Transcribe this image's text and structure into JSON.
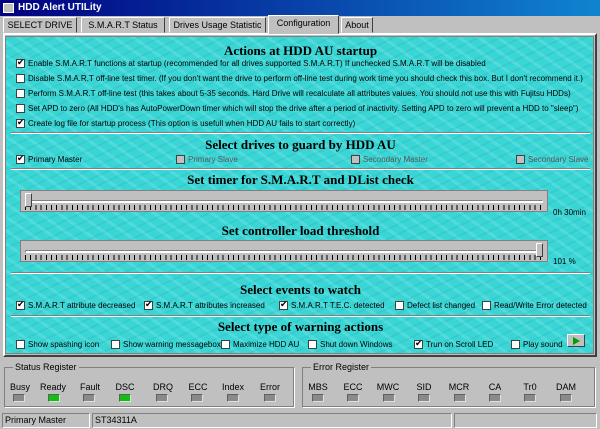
{
  "window": {
    "title": "HDD Alert UTILity"
  },
  "tabs": [
    {
      "label": "SELECT DRIVE"
    },
    {
      "label": "S.M.A.R.T Status"
    },
    {
      "label": "Drives Usage Statistic"
    },
    {
      "label": "Configuration"
    },
    {
      "label": "About"
    }
  ],
  "startup": {
    "heading": "Actions at HDD AU startup",
    "options": [
      {
        "label": "Enable S.M.A.R.T functions at startup (recommended for all drives supported S.M.A.R.T) If unchecked S.M.A.R.T will be disabled",
        "checked": true
      },
      {
        "label": "Disable S.M.A.R.T off-line test timer. (If you don't want the drive to perform off-line test during work time you should check this box. But I don't recommend it.)",
        "checked": false
      },
      {
        "label": "Perform S.M.A.R.T off-line test (this takes about 5-35 seconds. Hard Drive will recalculate all attributes values. You should not use this with Fujitsu HDDs)",
        "checked": false
      },
      {
        "label": "Set APD to zero (All HDD's has AutoPowerDown timer which will stop the drive after a period of inactivity. Setting APD to zero will prevent a HDD to \"sleep\")",
        "checked": false
      },
      {
        "label": "Create log file for startup process (This option is usefull when HDD AU fails to start correctly)",
        "checked": true
      }
    ]
  },
  "drives": {
    "heading": "Select drives to guard by HDD AU",
    "items": [
      {
        "label": "Primary Master",
        "checked": true,
        "enabled": true
      },
      {
        "label": "Primary Slave",
        "checked": false,
        "enabled": false
      },
      {
        "label": "Secondary Master",
        "checked": false,
        "enabled": false
      },
      {
        "label": "Secondary Slave",
        "checked": false,
        "enabled": false
      }
    ]
  },
  "timer": {
    "heading": "Set timer for S.M.A.R.T and DList check",
    "value_label": "0h 30min",
    "level": 0.0
  },
  "load": {
    "heading": "Set controller load threshold",
    "value_label": "101 %",
    "level": 1.0
  },
  "events": {
    "heading": "Select events to watch",
    "items": [
      {
        "label": "S.M.A.R.T attribute decreased",
        "checked": true
      },
      {
        "label": "S.M.A.R.T attributes increased",
        "checked": true
      },
      {
        "label": "S.M.A.R.T T.E.C. detected",
        "checked": true
      },
      {
        "label": "Defect list changed",
        "checked": false
      },
      {
        "label": "Read/Write Error detected",
        "checked": false
      }
    ]
  },
  "warnings": {
    "heading": "Select type of warning actions",
    "items": [
      {
        "label": "Show spashing icon",
        "checked": false
      },
      {
        "label": "Show warning messagebox",
        "checked": false
      },
      {
        "label": "Maximize HDD AU",
        "checked": false
      },
      {
        "label": "Shut down Windows",
        "checked": false
      },
      {
        "label": "Trun on Scroll LED",
        "checked": true
      },
      {
        "label": "Play sound",
        "checked": false
      }
    ]
  },
  "status_register": {
    "title": "Status Register",
    "bits": [
      {
        "label": "Busy",
        "on": false
      },
      {
        "label": "Ready",
        "on": true
      },
      {
        "label": "Fault",
        "on": false
      },
      {
        "label": "DSC",
        "on": true
      },
      {
        "label": "DRQ",
        "on": false
      },
      {
        "label": "ECC",
        "on": false
      },
      {
        "label": "Index",
        "on": false
      },
      {
        "label": "Error",
        "on": false
      }
    ]
  },
  "error_register": {
    "title": "Error Register",
    "bits": [
      {
        "label": "MBS",
        "on": false
      },
      {
        "label": "ECC",
        "on": false
      },
      {
        "label": "MWC",
        "on": false
      },
      {
        "label": "SID",
        "on": false
      },
      {
        "label": "MCR",
        "on": false
      },
      {
        "label": "CA",
        "on": false
      },
      {
        "label": "Tr0",
        "on": false
      },
      {
        "label": "DAM",
        "on": false
      }
    ]
  },
  "statusbar": {
    "drive": "Primary Master",
    "model": "ST34311A",
    "extra": ""
  },
  "colors": {
    "panel_bg": "#3ad6d6",
    "window": "#c0c0c0",
    "titlebar": "#000080",
    "led_on": "#10c010"
  }
}
